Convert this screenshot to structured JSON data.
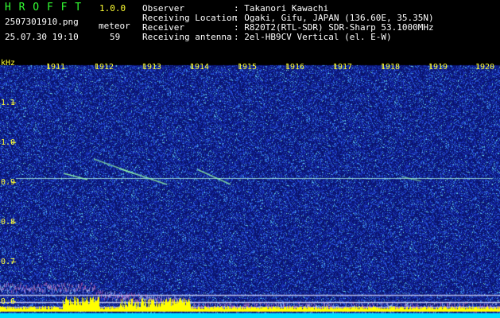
{
  "header": {
    "app_title": "H R O F F T",
    "version": "1.0.0",
    "filename": "2507301910.png",
    "meteor_label": "meteor",
    "timestamp": "25.07.30 19:10",
    "meteor_count": "59",
    "info_labels": {
      "observer": "Observer",
      "location": "Receiving Location",
      "receiver": "Receiver",
      "antenna": "Receiving antenna"
    },
    "info_values": {
      "observer": ": Takanori Kawachi",
      "location": ": Ogaki, Gifu, JAPAN (136.60E, 35.35N)",
      "receiver": ": R820T2(RTL-SDR) SDR-Sharp 53.1000MHz",
      "antenna": ": 2el-HB9CV Vertical (el. E-W)"
    }
  },
  "spectrogram": {
    "y_unit": "kHz",
    "y_ticks": [
      "1.1",
      "1.0",
      "0.9",
      "0.8",
      "0.7",
      "0.6"
    ],
    "x_ticks": [
      "1911",
      "1912",
      "1913",
      "1914",
      "1915",
      "1916",
      "1917",
      "1918",
      "1919",
      "1920"
    ]
  },
  "colors": {
    "background": "#000000",
    "noise_base": "#102090",
    "label_yellow": "#ffff33",
    "title_green": "#33ff33"
  }
}
